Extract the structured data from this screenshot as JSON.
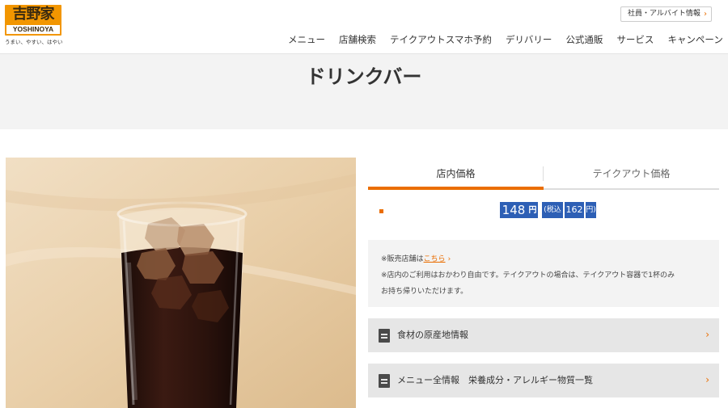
{
  "brand": {
    "logo_kanji": "吉野家",
    "logo_latin": "YOSHINOYA",
    "tagline": "うまい、やすい、はやい"
  },
  "header": {
    "recruit_label": "社員・アルバイト情報",
    "recruit_chevron": "›",
    "nav": [
      "メニュー",
      "店舗検索",
      "テイクアウトスマホ予約",
      "デリバリー",
      "公式通販",
      "サービス",
      "キャンペーン"
    ]
  },
  "page": {
    "title": "ドリンクバー"
  },
  "tabs": {
    "instore": "店内価格",
    "takeout": "テイクアウト価格"
  },
  "price": {
    "value": "148",
    "yen": "円",
    "tax_label": "(税込",
    "tax_value": "162",
    "tax_yen": "円)"
  },
  "notes": {
    "line1_prefix": "※販売店舗は",
    "line1_link": "こちら",
    "line1_chevron": "›",
    "line2": "※店内のご利用はおかわり自由です。テイクアウトの場合は、テイクアウト容器で1杯のみ",
    "line3": "お持ち帰りいただけます。"
  },
  "links": {
    "origin_label": "食材の原産地情報",
    "allinfo_label": "メニュー全情報　栄養成分・アレルギー物質一覧",
    "chevron": "›"
  },
  "icons": {
    "document": "document-icon",
    "chevron": "chevron-right-icon"
  },
  "colors": {
    "brand_orange": "#f29600",
    "accent": "#ea6d00",
    "highlight_blue": "#2d5fb5",
    "band_gray": "#f3f3f3",
    "bar_gray": "#e6e6e6"
  }
}
